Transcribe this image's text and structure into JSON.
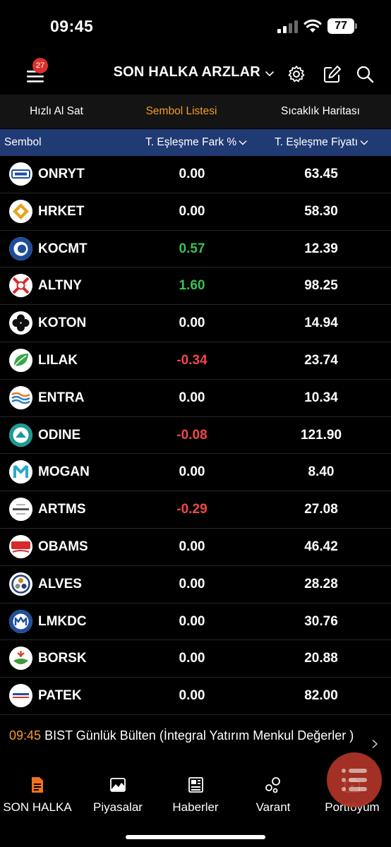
{
  "status": {
    "time": "09:45",
    "battery": "77"
  },
  "header": {
    "badge": "27",
    "title": "SON HALKA ARZLAR"
  },
  "tabs": [
    {
      "label": "Hızlı Al Sat"
    },
    {
      "label": "Sembol Listesi"
    },
    {
      "label": "Sıcaklık Haritası"
    }
  ],
  "table": {
    "headers": {
      "symbol": "Sembol",
      "fark": "T. Eşleşme Fark %",
      "fiyat": "T. Eşleşme Fiyatı"
    },
    "rows": [
      {
        "symbol": "ONRYT",
        "fark": "0.00",
        "fiyat": "63.45"
      },
      {
        "symbol": "HRKET",
        "fark": "0.00",
        "fiyat": "58.30"
      },
      {
        "symbol": "KOCMT",
        "fark": "0.57",
        "fiyat": "12.39"
      },
      {
        "symbol": "ALTNY",
        "fark": "1.60",
        "fiyat": "98.25"
      },
      {
        "symbol": "KOTON",
        "fark": "0.00",
        "fiyat": "14.94"
      },
      {
        "symbol": "LILAK",
        "fark": "-0.34",
        "fiyat": "23.74"
      },
      {
        "symbol": "ENTRA",
        "fark": "0.00",
        "fiyat": "10.34"
      },
      {
        "symbol": "ODINE",
        "fark": "-0.08",
        "fiyat": "121.90"
      },
      {
        "symbol": "MOGAN",
        "fark": "0.00",
        "fiyat": "8.40"
      },
      {
        "symbol": "ARTMS",
        "fark": "-0.29",
        "fiyat": "27.08"
      },
      {
        "symbol": "OBAMS",
        "fark": "0.00",
        "fiyat": "46.42"
      },
      {
        "symbol": "ALVES",
        "fark": "0.00",
        "fiyat": "28.28"
      },
      {
        "symbol": "LMKDC",
        "fark": "0.00",
        "fiyat": "30.76"
      },
      {
        "symbol": "BORSK",
        "fark": "0.00",
        "fiyat": "20.88"
      },
      {
        "symbol": "PATEK",
        "fark": "0.00",
        "fiyat": "82.00"
      }
    ]
  },
  "news": {
    "time": "09:45",
    "text": "BIST Günlük Bülten (İntegral Yatırım Menkul Değerler )"
  },
  "bottom_nav": [
    {
      "label": "SON HALKA",
      "icon": "document-icon"
    },
    {
      "label": "Piyasalar",
      "icon": "chart-icon"
    },
    {
      "label": "Haberler",
      "icon": "news-icon"
    },
    {
      "label": "Varant",
      "icon": "bubbles-icon"
    },
    {
      "label": "Portföyüm",
      "icon": "briefcase-icon"
    }
  ],
  "colors": {
    "accent": "#f59b26",
    "positive": "#36c256",
    "negative": "#f0474a",
    "table_header": "#203a73",
    "badge": "#d9322b"
  }
}
